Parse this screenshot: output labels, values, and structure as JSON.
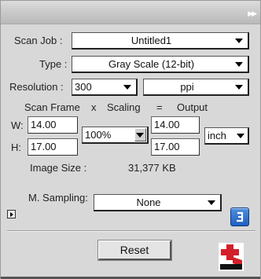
{
  "scan_job": {
    "label": "Scan Job :",
    "value": "Untitled1"
  },
  "type": {
    "label": "Type :",
    "value": "Gray Scale (12-bit)"
  },
  "resolution": {
    "label": "Resolution :",
    "value": "300",
    "unit": "ppi"
  },
  "headers": {
    "scan_frame": "Scan Frame",
    "x": "x",
    "scaling": "Scaling",
    "equals": "=",
    "output": "Output"
  },
  "width": {
    "label": "W:",
    "value": "14.00",
    "output": "14.00"
  },
  "height": {
    "label": "H:",
    "value": "17.00",
    "output": "17.00"
  },
  "scaling": {
    "value": "100%"
  },
  "units": {
    "value": "inch"
  },
  "image_size": {
    "label": "Image Size :",
    "value": "31,377 KB"
  },
  "m_sampling": {
    "label": "M. Sampling:",
    "value": "None"
  },
  "reset_label": "Reset",
  "icons": {
    "collapse": "double-chevron-right-icon",
    "disclosure": "triangle-right-icon",
    "blue_action": "square-bracket-icon",
    "logo": "microtek-logo"
  },
  "colors": {
    "accent_blue": "#2a6fd0",
    "logo_red": "#d31f2a"
  }
}
